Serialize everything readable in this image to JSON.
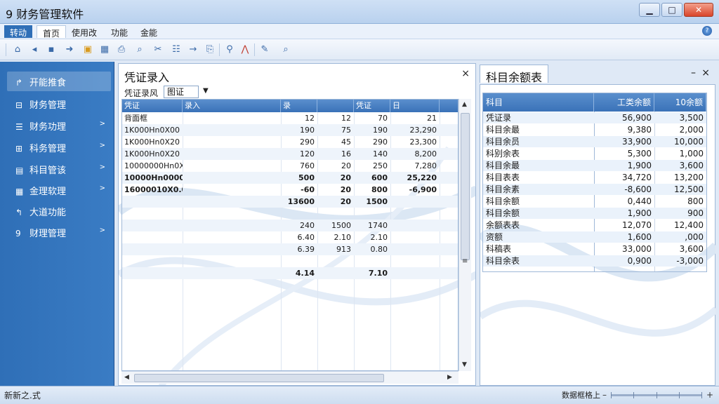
{
  "window": {
    "title": "9 财务管理软件",
    "minimize": "▁",
    "maximize": "□",
    "close": "✕"
  },
  "menu": {
    "items": [
      "转动",
      "首页",
      "使用改",
      "功能",
      "金能"
    ]
  },
  "toolbar": {
    "icons": [
      "home-icon",
      "back-icon",
      "save-icon",
      "forward-icon",
      "folder-icon",
      "grid-icon",
      "print-icon",
      "zoom-icon",
      "tools-icon",
      "table-icon",
      "arrow-icon",
      "copy-icon",
      "search-icon",
      "chart-icon",
      "edit-icon",
      "magnify-icon"
    ]
  },
  "sidebar": {
    "items": [
      {
        "label": "开能推食",
        "icon": "↱",
        "chevron": ""
      },
      {
        "label": "财务管理",
        "icon": "⊟",
        "chevron": ""
      },
      {
        "label": "财务功理",
        "icon": "☰",
        "chevron": ">"
      },
      {
        "label": "科务管理",
        "icon": "⊞",
        "chevron": ">"
      },
      {
        "label": "科目管该",
        "icon": "▤",
        "chevron": ">"
      },
      {
        "label": "金理软理",
        "icon": "▦",
        "chevron": ">"
      },
      {
        "label": "大道功能",
        "icon": "↰",
        "chevron": ""
      },
      {
        "label": "财理管理",
        "icon": "9",
        "chevron": ">"
      }
    ]
  },
  "voucher": {
    "title": "凭证录入",
    "close": "×",
    "type_label": "凭证录风",
    "type_value": "图证",
    "columns": [
      "凭证",
      "录入",
      "录",
      "",
      "凭证",
      "日"
    ],
    "rows": [
      {
        "c": [
          "背面框",
          "",
          "12",
          "12",
          "70",
          "21"
        ],
        "bold": false
      },
      {
        "c": [
          "1K000Hn0X00",
          "",
          "190",
          "75",
          "190",
          "23,290"
        ],
        "bold": false
      },
      {
        "c": [
          "1K000Hn0X20",
          "",
          "290",
          "45",
          "290",
          "23,300"
        ],
        "bold": false
      },
      {
        "c": [
          "1K000Hn0X20",
          "",
          "120",
          "16",
          "140",
          "8,200"
        ],
        "bold": false
      },
      {
        "c": [
          "10000000Hn0X20",
          "",
          "760",
          "20",
          "250",
          "7,280"
        ],
        "bold": false
      },
      {
        "c": [
          "10000Hn0000",
          "",
          "500",
          "20",
          "600",
          "25,220"
        ],
        "bold": true
      },
      {
        "c": [
          "16000010X0.00",
          "",
          "-60",
          "20",
          "800",
          "-6,900"
        ],
        "bold": true
      },
      {
        "c": [
          "",
          "",
          "13600",
          "20",
          "1500",
          ""
        ],
        "bold": true
      },
      {
        "c": [
          "",
          "",
          "",
          "",
          "",
          ""
        ],
        "bold": false
      },
      {
        "c": [
          "",
          "",
          "240",
          "1500",
          "1740",
          ""
        ],
        "bold": false
      },
      {
        "c": [
          "",
          "",
          "6.40",
          "2.10",
          "2.10",
          ""
        ],
        "bold": false
      },
      {
        "c": [
          "",
          "",
          "6.39",
          "913",
          "0.80",
          ""
        ],
        "bold": false
      },
      {
        "c": [
          "",
          "",
          "",
          "",
          "",
          ""
        ],
        "bold": false
      },
      {
        "c": [
          "",
          "",
          "4.14",
          "",
          "7.10",
          ""
        ],
        "bold": true
      }
    ]
  },
  "balance": {
    "title": "科目余额表",
    "minimize": "–",
    "close": "×",
    "columns": [
      "科目",
      "工类余额",
      "10余额"
    ],
    "rows": [
      [
        "凭证录",
        "56,900",
        "3,500"
      ],
      [
        "科目余最",
        "9,380",
        "2,000"
      ],
      [
        "科目余员",
        "33,900",
        "10,000"
      ],
      [
        "科别余表",
        "5,300",
        "1,000"
      ],
      [
        "科目余最",
        "1,900",
        "3,600"
      ],
      [
        "科目表表",
        "34,720",
        "13,200"
      ],
      [
        "科目余素",
        "-8,600",
        "12,500"
      ],
      [
        "科目余额",
        "0,440",
        "800"
      ],
      [
        "科目余额",
        "1,900",
        "900"
      ],
      [
        "余额表表",
        "12,070",
        "12,400"
      ],
      [
        "资额",
        "1,600",
        ",000"
      ],
      [
        "科稿表",
        "33,000",
        "3,600"
      ],
      [
        "科目余表",
        "0,900",
        "-3,000"
      ]
    ]
  },
  "status": {
    "left": "新新之.式",
    "right": "数据框格上"
  }
}
